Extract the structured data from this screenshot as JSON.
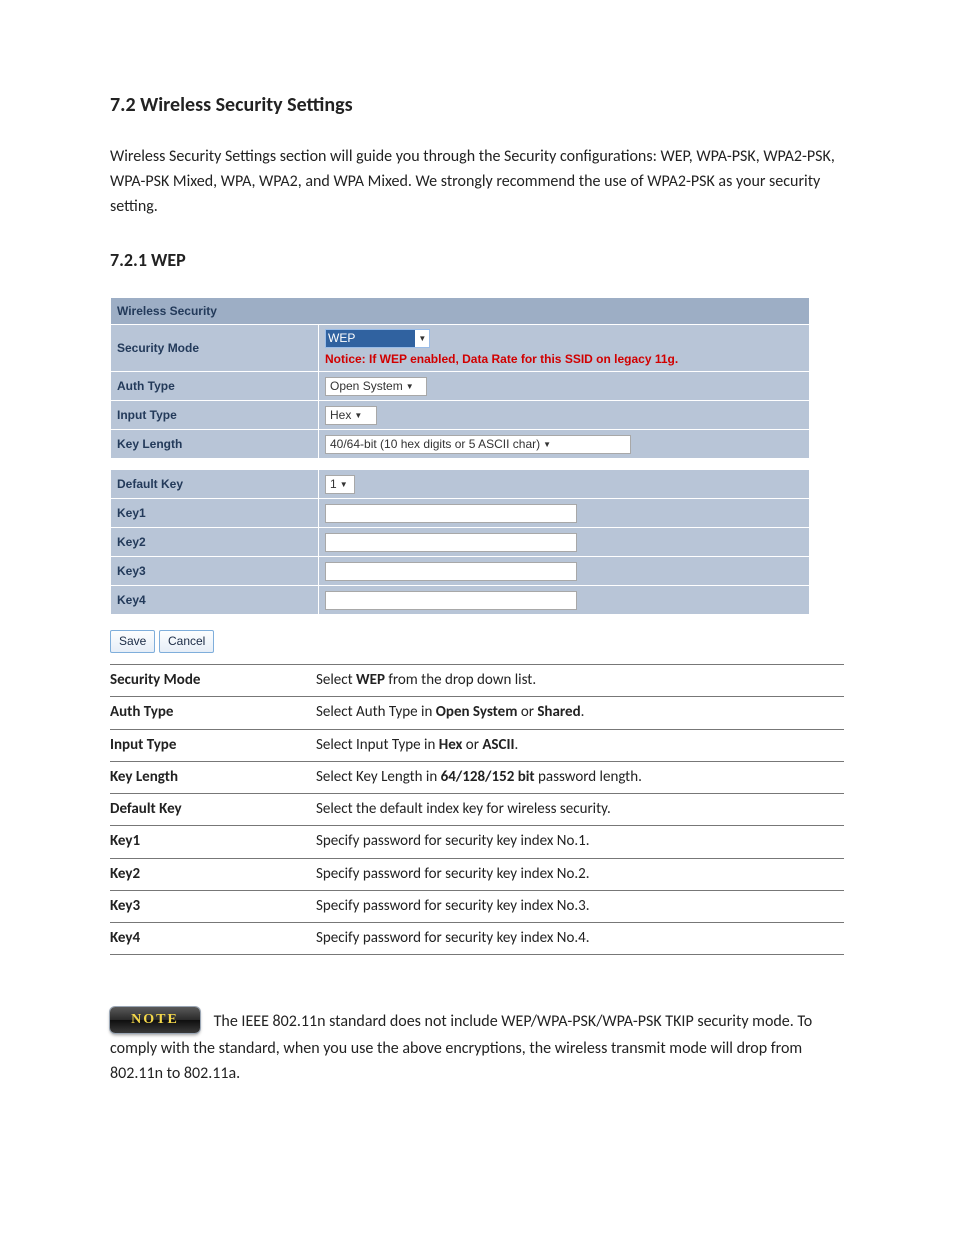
{
  "section": {
    "title": "7.2 Wireless Security Settings",
    "intro": "Wireless Security Settings section will guide you through the Security configurations: WEP, WPA-PSK, WPA2-PSK, WPA-PSK Mixed, WPA, WPA2, and WPA Mixed. We strongly recommend the use of WPA2-PSK as your security setting."
  },
  "subsection": {
    "title": "7.2.1 WEP"
  },
  "form": {
    "header": "Wireless Security",
    "rows": {
      "security_mode": {
        "label": "Security Mode",
        "value": "WEP",
        "notice": "Notice: If WEP enabled, Data Rate for this SSID on legacy 11g."
      },
      "auth_type": {
        "label": "Auth Type",
        "value": "Open System"
      },
      "input_type": {
        "label": "Input Type",
        "value": "Hex"
      },
      "key_length": {
        "label": "Key Length",
        "value": "40/64-bit (10 hex digits or 5 ASCII char)"
      },
      "default_key": {
        "label": "Default Key",
        "value": "1"
      },
      "key1": {
        "label": "Key1",
        "value": ""
      },
      "key2": {
        "label": "Key2",
        "value": ""
      },
      "key3": {
        "label": "Key3",
        "value": ""
      },
      "key4": {
        "label": "Key4",
        "value": ""
      }
    },
    "buttons": {
      "save": "Save",
      "cancel": "Cancel"
    }
  },
  "desc": [
    {
      "term": "Security Mode",
      "parts": [
        "Select ",
        "WEP",
        " from the drop down list."
      ],
      "bold": [
        1
      ]
    },
    {
      "term": "Auth Type",
      "parts": [
        "Select Auth Type in ",
        "Open System",
        " or ",
        "Shared",
        "."
      ],
      "bold": [
        1,
        3
      ]
    },
    {
      "term": "Input Type",
      "parts": [
        "Select Input Type in ",
        "Hex",
        " or ",
        "ASCII",
        "."
      ],
      "bold": [
        1,
        3
      ]
    },
    {
      "term": "Key Length",
      "parts": [
        "Select Key Length in ",
        "64/128/152 bit",
        " password length."
      ],
      "bold": [
        1
      ]
    },
    {
      "term": "Default Key",
      "parts": [
        "Select the default index key for wireless security."
      ],
      "bold": []
    },
    {
      "term": "Key1",
      "parts": [
        "Specify password for security key index No.1."
      ],
      "bold": []
    },
    {
      "term": "Key2",
      "parts": [
        "Specify password for security key index No.2."
      ],
      "bold": []
    },
    {
      "term": "Key3",
      "parts": [
        "Specify password for security key index No.3."
      ],
      "bold": []
    },
    {
      "term": "Key4",
      "parts": [
        "Specify password for security key index No.4."
      ],
      "bold": []
    }
  ],
  "note": {
    "badge": "NOTE",
    "text": "The IEEE 802.11n standard does not include WEP/WPA-PSK/WPA-PSK TKIP security mode. To comply with the standard, when you use the above encryptions, the wireless transmit mode will drop from 802.11n to 802.11a."
  }
}
